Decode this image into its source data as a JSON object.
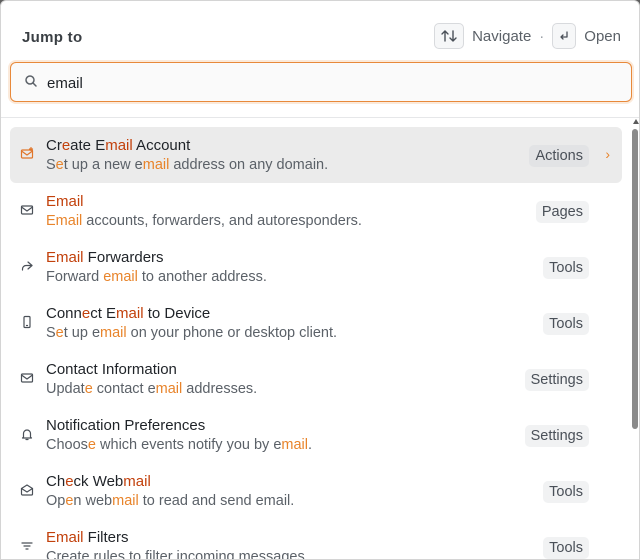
{
  "header": {
    "title": "Jump to",
    "navigate_label": "Navigate",
    "separator": "·",
    "open_label": "Open",
    "navigate_key_icon": "up-down-arrows-icon",
    "open_key_icon": "enter-key-icon"
  },
  "search": {
    "value": "email",
    "placeholder": "",
    "icon": "search-icon"
  },
  "colors": {
    "accent": "#e8842b",
    "title_highlight": "#c2410c",
    "selected_bg": "#ebebeb"
  },
  "results": [
    {
      "icon": "mail-plus-icon",
      "title_parts": [
        [
          "Cr",
          false
        ],
        [
          "e",
          true
        ],
        [
          "ate E",
          false
        ],
        [
          "mail",
          true
        ],
        [
          " Account",
          false
        ]
      ],
      "sub_parts": [
        [
          "S",
          false
        ],
        [
          "e",
          true
        ],
        [
          "t up a new e",
          false
        ],
        [
          "mail",
          true
        ],
        [
          " address on any domain.",
          false
        ]
      ],
      "tag": "Actions",
      "selected": true
    },
    {
      "icon": "mail-icon",
      "title_parts": [
        [
          "Email",
          true
        ]
      ],
      "sub_parts": [
        [
          "Email",
          true
        ],
        [
          " accounts, forwarders, and autoresponders.",
          false
        ]
      ],
      "tag": "Pages",
      "selected": false
    },
    {
      "icon": "forward-icon",
      "title_parts": [
        [
          "Email",
          true
        ],
        [
          " Forwarders",
          false
        ]
      ],
      "sub_parts": [
        [
          "Forward ",
          false
        ],
        [
          "email",
          true
        ],
        [
          " to another address.",
          false
        ]
      ],
      "tag": "Tools",
      "selected": false
    },
    {
      "icon": "phone-icon",
      "title_parts": [
        [
          "Conn",
          false
        ],
        [
          "e",
          true
        ],
        [
          "ct E",
          false
        ],
        [
          "mail",
          true
        ],
        [
          " to Device",
          false
        ]
      ],
      "sub_parts": [
        [
          "S",
          false
        ],
        [
          "e",
          true
        ],
        [
          "t up e",
          false
        ],
        [
          "mail",
          true
        ],
        [
          " on your phone or desktop client.",
          false
        ]
      ],
      "tag": "Tools",
      "selected": false
    },
    {
      "icon": "mail-icon",
      "title_parts": [
        [
          "Contact Information",
          false
        ]
      ],
      "sub_parts": [
        [
          "Updat",
          false
        ],
        [
          "e",
          true
        ],
        [
          " contact e",
          false
        ],
        [
          "mail",
          true
        ],
        [
          " addresses.",
          false
        ]
      ],
      "tag": "Settings",
      "selected": false
    },
    {
      "icon": "bell-icon",
      "title_parts": [
        [
          "Notification Preferences",
          false
        ]
      ],
      "sub_parts": [
        [
          "Choos",
          false
        ],
        [
          "e",
          true
        ],
        [
          " which events notify you by e",
          false
        ],
        [
          "mail",
          true
        ],
        [
          ".",
          false
        ]
      ],
      "tag": "Settings",
      "selected": false
    },
    {
      "icon": "mail-open-icon",
      "title_parts": [
        [
          "Ch",
          false
        ],
        [
          "e",
          true
        ],
        [
          "ck Web",
          false
        ],
        [
          "mail",
          true
        ]
      ],
      "sub_parts": [
        [
          "Op",
          false
        ],
        [
          "e",
          true
        ],
        [
          "n web",
          false
        ],
        [
          "mail",
          true
        ],
        [
          " to read and send email.",
          false
        ]
      ],
      "tag": "Tools",
      "selected": false
    },
    {
      "icon": "filter-icon",
      "title_parts": [
        [
          "Email",
          true
        ],
        [
          " Filters",
          false
        ]
      ],
      "sub_parts": [
        [
          "Create rules to filter incoming messages.",
          false
        ]
      ],
      "tag": "Tools",
      "selected": false
    }
  ]
}
